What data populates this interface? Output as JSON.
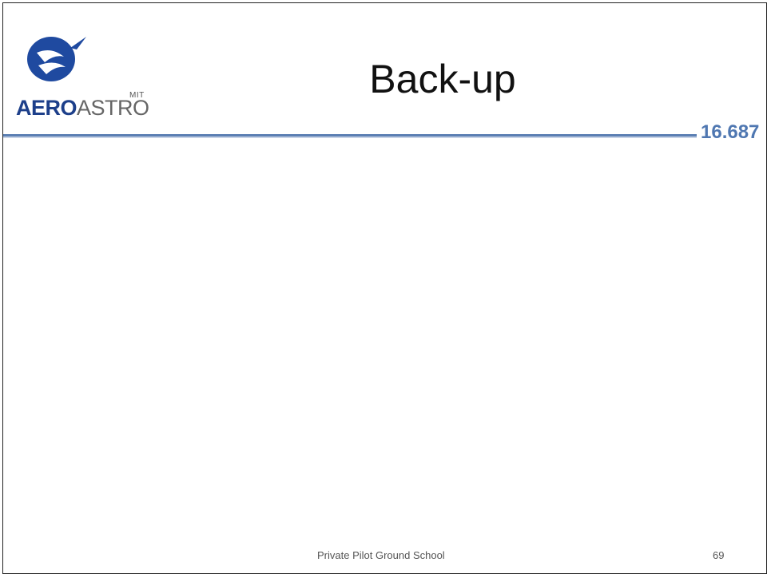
{
  "slide": {
    "title": "Back-up",
    "course_number": "16.687",
    "footer": "Private Pilot Ground School",
    "page_number": "69"
  },
  "logo": {
    "small_text": "MIT",
    "word_left": "AERO",
    "word_right": "ASTRO",
    "icon": "aeroastro-swoosh-logo-icon"
  },
  "colors": {
    "rule": "#5b7fb3",
    "accent_text": "#4f77b1",
    "logo_blue": "#1d3f8a"
  }
}
